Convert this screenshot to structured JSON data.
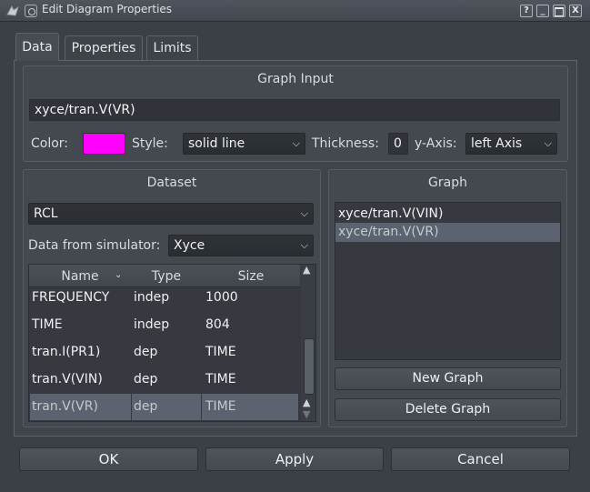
{
  "window": {
    "title": "Edit Diagram Properties",
    "help_label": "?",
    "min_label": "_",
    "close_label": "X"
  },
  "tabs": [
    "Data",
    "Properties",
    "Limits"
  ],
  "graph_input": {
    "title": "Graph Input",
    "value": "xyce/tran.V(VR)",
    "color_label": "Color:",
    "color": "#ff00ff",
    "style_label": "Style:",
    "style_value": "solid line",
    "thickness_label": "Thickness:",
    "thickness_value": "0",
    "yaxis_label": "y-Axis:",
    "yaxis_value": "left Axis"
  },
  "dataset": {
    "title": "Dataset",
    "selected": "RCL",
    "from_sim_label": "Data from simulator:",
    "simulator": "Xyce",
    "columns": [
      "Name",
      "Type",
      "Size"
    ],
    "rows": [
      {
        "name": "FREQUENCY",
        "type": "indep",
        "size": "1000"
      },
      {
        "name": "TIME",
        "type": "indep",
        "size": "804"
      },
      {
        "name": "tran.I(PR1)",
        "type": "dep",
        "size": "TIME"
      },
      {
        "name": "tran.V(VIN)",
        "type": "dep",
        "size": "TIME"
      },
      {
        "name": "tran.V(VR)",
        "type": "dep",
        "size": "TIME"
      }
    ]
  },
  "graph": {
    "title": "Graph",
    "items": [
      "xyce/tran.V(VIN)",
      "xyce/tran.V(VR)"
    ],
    "new_label": "New Graph",
    "delete_label": "Delete Graph"
  },
  "buttons": {
    "ok": "OK",
    "apply": "Apply",
    "cancel": "Cancel"
  }
}
